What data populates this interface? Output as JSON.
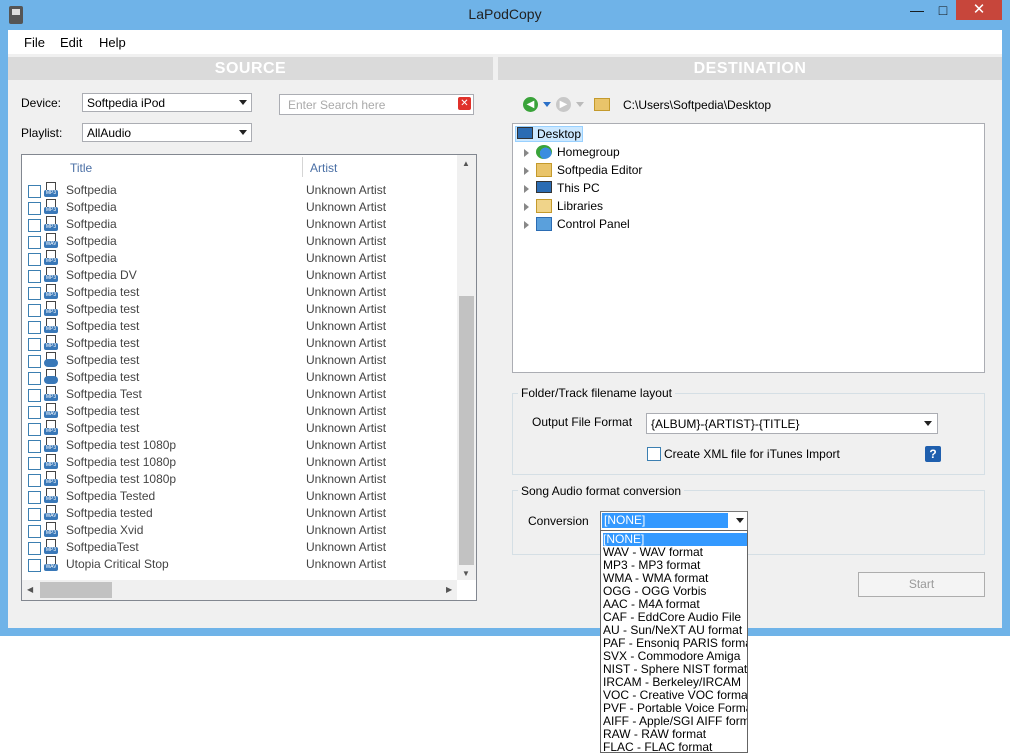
{
  "window": {
    "title": "LaPodCopy",
    "minimize": "—",
    "maximize": "□",
    "close": "✕"
  },
  "menu": [
    "File",
    "Edit",
    "Help"
  ],
  "source": {
    "header": "SOURCE",
    "device_label": "Device:",
    "device_value": "Softpedia iPod",
    "playlist_label": "Playlist:",
    "playlist_value": "AllAudio",
    "search_placeholder": "Enter Search here",
    "columns": {
      "title": "Title",
      "artist": "Artist"
    },
    "tracks": [
      {
        "title": "Softpedia",
        "artist": "Unknown Artist",
        "tag": "MP3"
      },
      {
        "title": "Softpedia",
        "artist": "Unknown Artist",
        "tag": "MP3"
      },
      {
        "title": "Softpedia",
        "artist": "Unknown Artist",
        "tag": "MP3"
      },
      {
        "title": "Softpedia",
        "artist": "Unknown Artist",
        "tag": "WAV"
      },
      {
        "title": "Softpedia",
        "artist": "Unknown Artist",
        "tag": "MP3"
      },
      {
        "title": "Softpedia DV",
        "artist": "Unknown Artist",
        "tag": "MP3"
      },
      {
        "title": "Softpedia test",
        "artist": "Unknown Artist",
        "tag": "MP3"
      },
      {
        "title": "Softpedia test",
        "artist": "Unknown Artist",
        "tag": "MP3"
      },
      {
        "title": "Softpedia test",
        "artist": "Unknown Artist",
        "tag": "MP3"
      },
      {
        "title": "Softpedia test",
        "artist": "Unknown Artist",
        "tag": "MP3"
      },
      {
        "title": "Softpedia test",
        "artist": "Unknown Artist",
        "tag": ""
      },
      {
        "title": "Softpedia test",
        "artist": "Unknown Artist",
        "tag": ""
      },
      {
        "title": "Softpedia Test",
        "artist": "Unknown Artist",
        "tag": "MP3"
      },
      {
        "title": "Softpedia test",
        "artist": "Unknown Artist",
        "tag": "WAV"
      },
      {
        "title": "Softpedia test",
        "artist": "Unknown Artist",
        "tag": "MP3"
      },
      {
        "title": "Softpedia test 1080p",
        "artist": "Unknown Artist",
        "tag": "MP3"
      },
      {
        "title": "Softpedia test 1080p",
        "artist": "Unknown Artist",
        "tag": "MP3"
      },
      {
        "title": "Softpedia test 1080p",
        "artist": "Unknown Artist",
        "tag": "MP3"
      },
      {
        "title": "Softpedia Tested",
        "artist": "Unknown Artist",
        "tag": "MP3"
      },
      {
        "title": "Softpedia tested",
        "artist": "Unknown Artist",
        "tag": "WAV"
      },
      {
        "title": "Softpedia Xvid",
        "artist": "Unknown Artist",
        "tag": "MP3"
      },
      {
        "title": "SoftpediaTest",
        "artist": "Unknown Artist",
        "tag": "MP3"
      },
      {
        "title": "Utopia Critical Stop",
        "artist": "Unknown Artist",
        "tag": "WAV"
      }
    ]
  },
  "destination": {
    "header": "DESTINATION",
    "path": "C:\\Users\\Softpedia\\Desktop",
    "tree": [
      {
        "label": "Desktop",
        "icon": "desktop-icon",
        "root": true
      },
      {
        "label": "Homegroup",
        "icon": "homegroup-icon"
      },
      {
        "label": "Softpedia Editor",
        "icon": "user-folder-icon"
      },
      {
        "label": "This PC",
        "icon": "computer-icon"
      },
      {
        "label": "Libraries",
        "icon": "libraries-icon"
      },
      {
        "label": "Control Panel",
        "icon": "control-panel-icon"
      }
    ],
    "layout_group": {
      "title": "Folder/Track filename layout",
      "output_label": "Output File Format",
      "output_value": "{ALBUM}-{ARTIST}-{TITLE}",
      "xml_label": "Create XML file for iTunes Import"
    },
    "conversion_group": {
      "title": "Song Audio format conversion",
      "conversion_label": "Conversion",
      "selected": "[NONE]",
      "options": [
        "[NONE]",
        "WAV - WAV format",
        "MP3 - MP3 format",
        "WMA - WMA format",
        "OGG - OGG Vorbis",
        "AAC - M4A format",
        "CAF - EddCore Audio File",
        "AU - Sun/NeXT AU format",
        "PAF - Ensoniq PARIS format",
        "SVX - Commodore Amiga",
        "NIST - Sphere NIST format",
        "IRCAM - Berkeley/IRCAM",
        "VOC - Creative VOC format",
        "PVF - Portable Voice Format",
        "AIFF - Apple/SGI AIFF format",
        "RAW - RAW format",
        "FLAC - FLAC format"
      ]
    },
    "start_label": "Start"
  },
  "colors": {
    "accent": "#3399ff",
    "frame": "#6fb3e8",
    "close": "#c7463b"
  }
}
